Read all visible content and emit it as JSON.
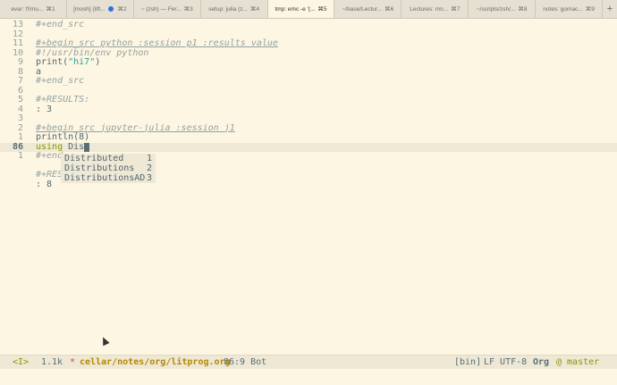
{
  "tabs": [
    {
      "label": "evar: f!!mu...",
      "shortcut": "⌘1",
      "dot": false
    },
    {
      "label": "[mosh] (lift...",
      "shortcut": "⌘2",
      "dot": true
    },
    {
      "label": "~ (zsh) — Fer...",
      "shortcut": "⌘3",
      "dot": false
    },
    {
      "label": "setup: julia (z...",
      "shortcut": "⌘4",
      "dot": false
    },
    {
      "label": "tmp: emc -e '(...",
      "shortcut": "⌘5",
      "dot": false,
      "active": true
    },
    {
      "label": "~/base/Lectur...",
      "shortcut": "⌘6",
      "dot": false
    },
    {
      "label": "Lectures: mn...",
      "shortcut": "⌘7",
      "dot": false
    },
    {
      "label": "~/scripts/zsh/...",
      "shortcut": "⌘8",
      "dot": false
    },
    {
      "label": "notes: gomac...",
      "shortcut": "⌘9",
      "dot": false
    }
  ],
  "new_tab_label": "+",
  "lines": [
    {
      "n": "13",
      "text": "#+end_src",
      "style": "comment"
    },
    {
      "n": "12",
      "text": "",
      "style": "plain"
    },
    {
      "n": "11",
      "text": "#+begin_src python :session p1 :results value",
      "style": "header"
    },
    {
      "n": "10",
      "text": "#!/usr/bin/env python",
      "style": "comment"
    },
    {
      "n": "9",
      "text": "print(\"hi7\")",
      "style": "print"
    },
    {
      "n": "8",
      "text": "a",
      "style": "plain"
    },
    {
      "n": "7",
      "text": "#+end_src",
      "style": "comment"
    },
    {
      "n": "6",
      "text": "",
      "style": "plain"
    },
    {
      "n": "5",
      "text": "#+RESULTS:",
      "style": "comment"
    },
    {
      "n": "4",
      "text": ": 3",
      "style": "plain"
    },
    {
      "n": "3",
      "text": "",
      "style": "plain"
    },
    {
      "n": "2",
      "text": "#+begin_src jupyter-julia :session j1",
      "style": "header"
    },
    {
      "n": "1",
      "text": "println(8)",
      "style": "plain"
    },
    {
      "n": "86",
      "text": "using Dis",
      "style": "current"
    },
    {
      "n": "1",
      "text": "#+end",
      "style": "comment"
    },
    {
      "n": "",
      "text": "",
      "style": "plain"
    },
    {
      "n": "",
      "text": "#+RES",
      "style": "comment"
    },
    {
      "n": "",
      "text": ": 8",
      "style": "plain"
    }
  ],
  "completions": [
    {
      "name": "Distributed",
      "index": "1"
    },
    {
      "name": "Distributions",
      "index": "2"
    },
    {
      "name": "DistributionsAD",
      "index": "3"
    }
  ],
  "modeline": {
    "mode": "<I>",
    "size": "1.1k",
    "modified": "*",
    "path": "cellar/notes/org/litprog.org",
    "position": "86:9 Bot",
    "encoding1": "[bin]",
    "encoding2": "LF UTF-8",
    "major_mode": "Org",
    "branch": "@ master"
  }
}
